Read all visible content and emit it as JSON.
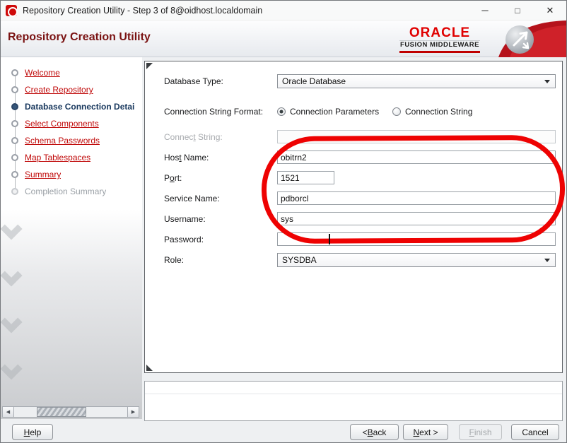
{
  "window": {
    "title": "Repository Creation Utility - Step 3 of 8@oidhost.localdomain",
    "controls": {
      "minimize": "─",
      "maximize": "□",
      "close": "✕"
    }
  },
  "header": {
    "title": "Repository Creation Utility",
    "brand": {
      "name": "ORACLE",
      "subtitle": "FUSION MIDDLEWARE"
    }
  },
  "sidebar": {
    "steps": [
      {
        "label": "Welcome",
        "state": "link"
      },
      {
        "label": "Create Repository",
        "state": "link"
      },
      {
        "label": "Database Connection Details",
        "state": "current"
      },
      {
        "label": "Select Components",
        "state": "link"
      },
      {
        "label": "Schema Passwords",
        "state": "link"
      },
      {
        "label": "Map Tablespaces",
        "state": "link"
      },
      {
        "label": "Summary",
        "state": "link"
      },
      {
        "label": "Completion Summary",
        "state": "disabled"
      }
    ]
  },
  "form": {
    "database_type": {
      "label": "Database Type:",
      "value": "Oracle Database"
    },
    "connection_string_format": {
      "label": "Connection String Format:",
      "options": [
        {
          "label": "Connection Parameters",
          "selected": true
        },
        {
          "label": "Connection String",
          "selected": false
        }
      ]
    },
    "connect_string": {
      "label_pre": "Connec",
      "label_mn": "t",
      "label_post": " String:",
      "value": "",
      "disabled": true
    },
    "host_name": {
      "label_pre": "Hos",
      "label_mn": "t",
      "label_post": " Name:",
      "value": "obitrn2"
    },
    "port": {
      "label_pre": "P",
      "label_mn": "o",
      "label_post": "rt:",
      "value": "1521"
    },
    "service_name": {
      "label": "Service Name:",
      "value": "pdborcl"
    },
    "username": {
      "label": "Username:",
      "value": "sys"
    },
    "password": {
      "label": "Password:",
      "value": ""
    },
    "role": {
      "label": "Role:",
      "value": "SYSDBA"
    }
  },
  "footer": {
    "help": {
      "pre": "",
      "mn": "H",
      "post": "elp"
    },
    "back": {
      "pre": "< ",
      "mn": "B",
      "post": "ack"
    },
    "next": {
      "pre": "",
      "mn": "N",
      "post": "ext >"
    },
    "finish": {
      "pre": "",
      "mn": "F",
      "post": "inish"
    },
    "cancel": {
      "label": "Cancel"
    }
  },
  "icons": {
    "scroll_left": "◀",
    "scroll_right": "▶"
  },
  "colors": {
    "link_red": "#c00a0a",
    "current_step_blue": "#16365c",
    "header_title_maroon": "#7a1212",
    "oracle_red": "#e00000",
    "annotation_red": "#ee0202"
  }
}
